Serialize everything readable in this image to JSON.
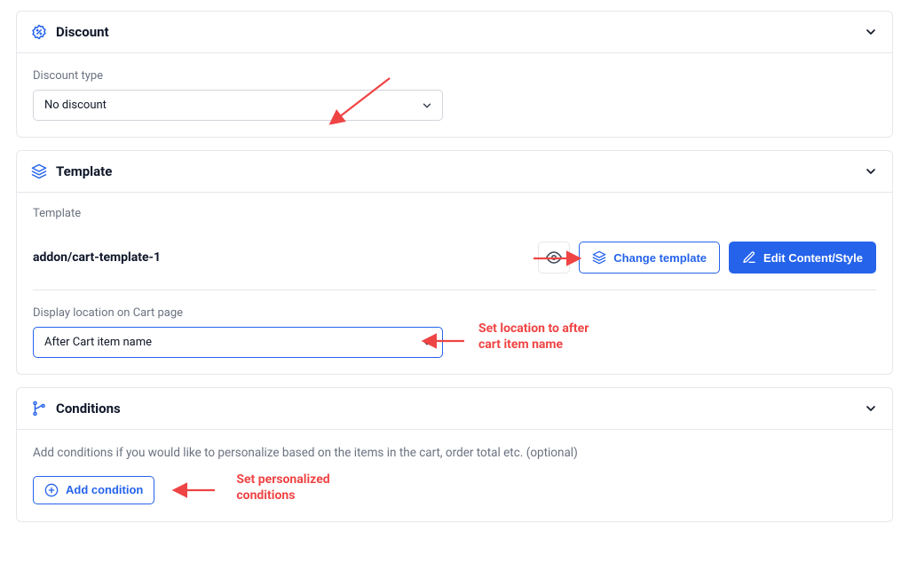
{
  "discount": {
    "section_title": "Discount",
    "type_label": "Discount type",
    "type_value": "No discount"
  },
  "template": {
    "section_title": "Template",
    "label": "Template",
    "name": "addon/cart-template-1",
    "change_label": "Change template",
    "edit_label": "Edit Content/Style",
    "location_label": "Display location on Cart page",
    "location_value": "After Cart item name"
  },
  "conditions": {
    "section_title": "Conditions",
    "description": "Add conditions if you would like to personalize based on the items in the cart, order total etc. (optional)",
    "add_label": "Add condition"
  },
  "annotations": {
    "location_note": "Set location to after\ncart item name",
    "conditions_note": "Set personalized\nconditions"
  },
  "colors": {
    "primary": "#2563eb",
    "danger": "#ef4444"
  }
}
